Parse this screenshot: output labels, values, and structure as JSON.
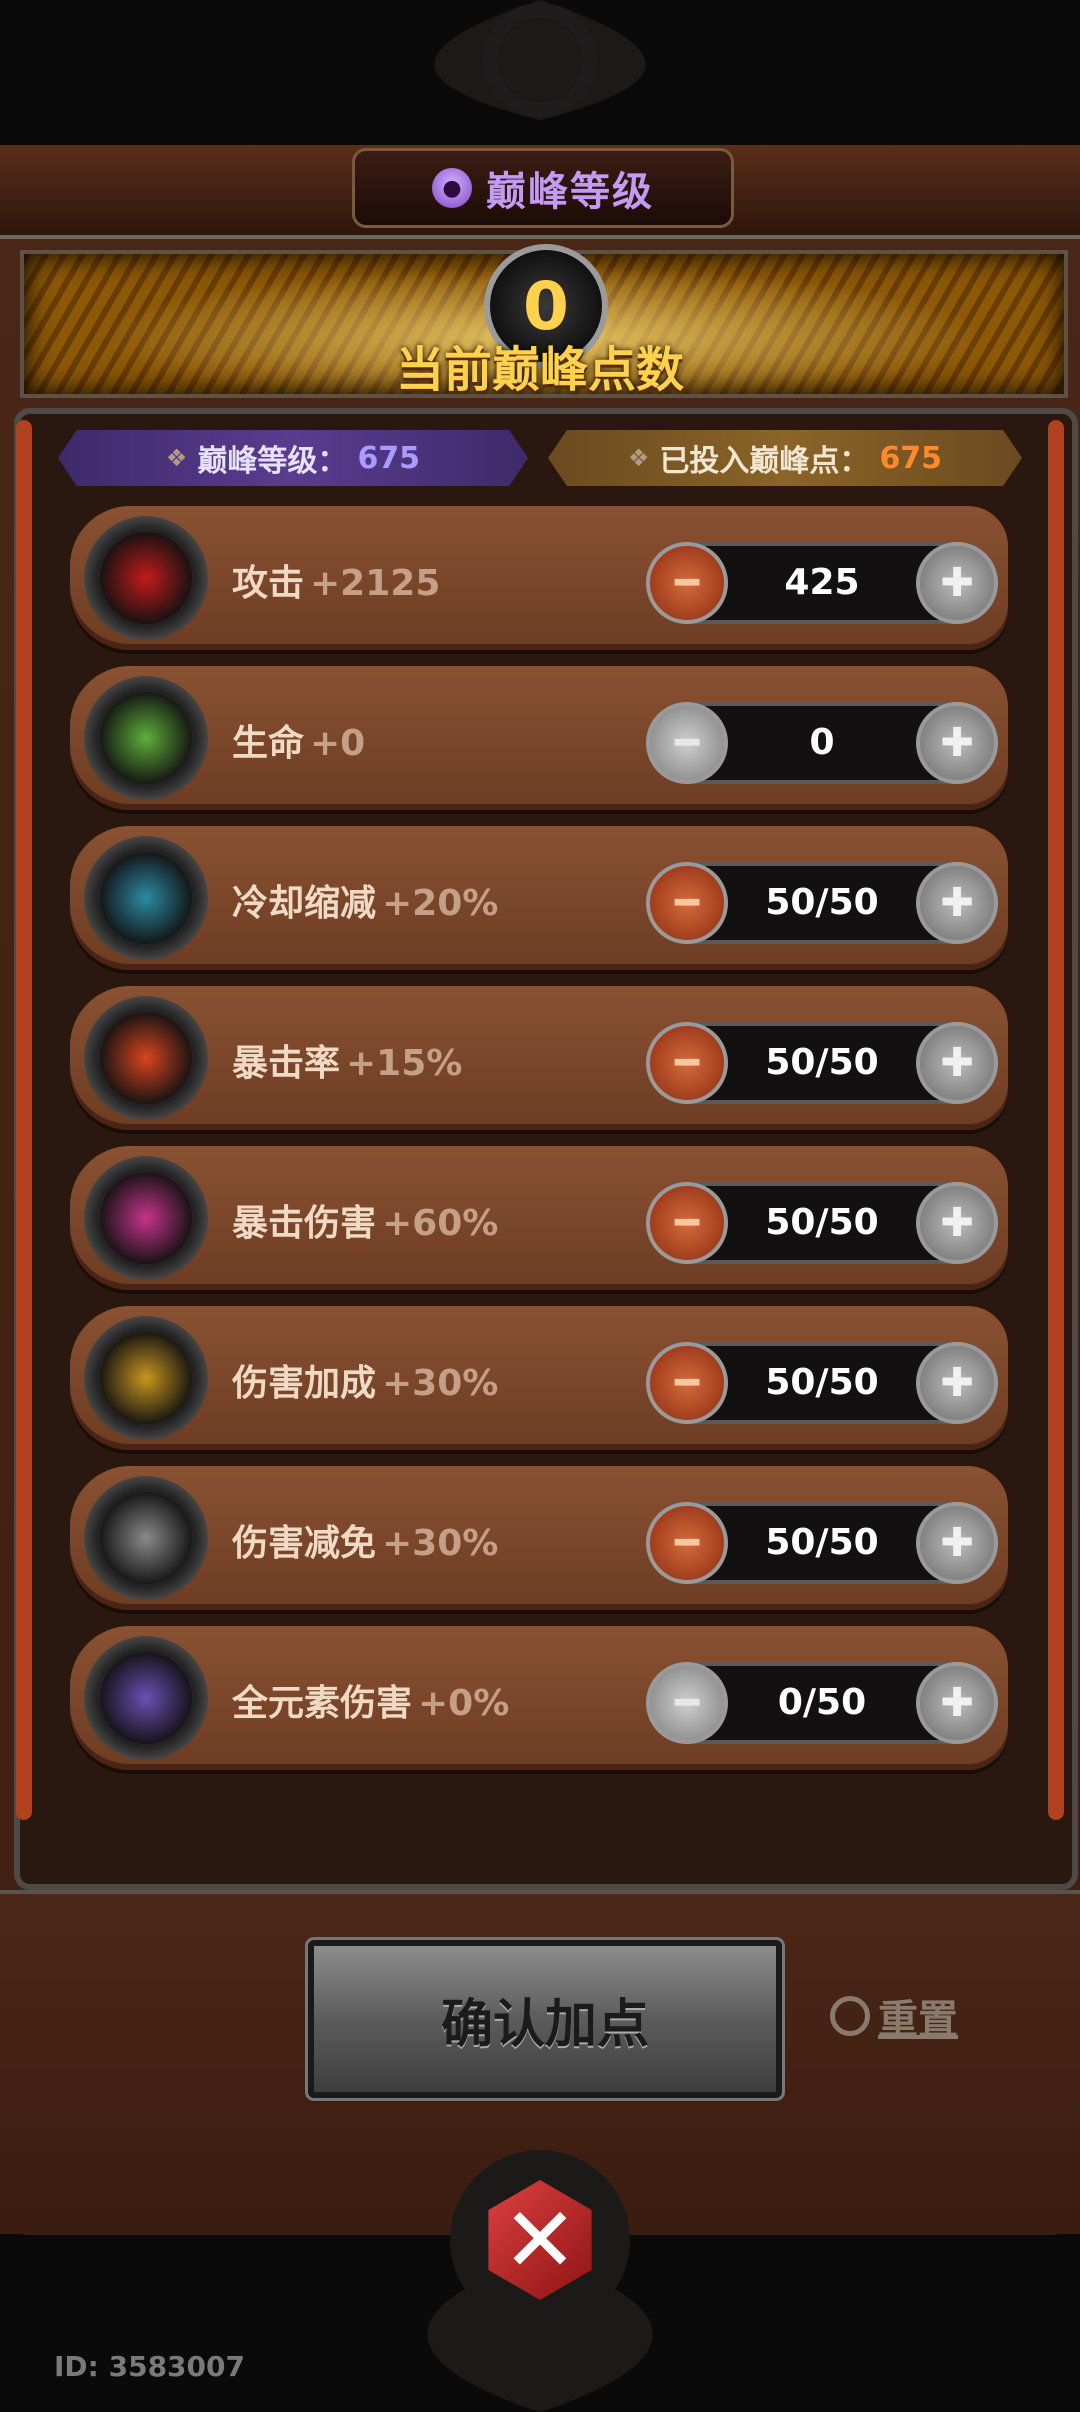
{
  "header": {
    "title": "巅峰等级"
  },
  "points": {
    "value": "0",
    "label": "当前巅峰点数"
  },
  "info": {
    "level_label": "巅峰等级：",
    "level_value": "675",
    "invested_label": "已投入巅峰点：",
    "invested_value": "675"
  },
  "rows": [
    {
      "name": "攻击",
      "bonus": "+2125",
      "value": "425",
      "minus_enabled": true,
      "icon": "attack-target-icon",
      "color": "#c21b1b"
    },
    {
      "name": "生命",
      "bonus": "+0",
      "value": "0",
      "minus_enabled": false,
      "icon": "life-cross-icon",
      "color": "#5fae3a"
    },
    {
      "name": "冷却缩减",
      "bonus": "+20%",
      "value": "50/50",
      "minus_enabled": true,
      "icon": "cooldown-clock-icon",
      "color": "#2b8aa3"
    },
    {
      "name": "暴击率",
      "bonus": "+15%",
      "value": "50/50",
      "minus_enabled": true,
      "icon": "crit-rate-spike-icon",
      "color": "#d8451f"
    },
    {
      "name": "暴击伤害",
      "bonus": "+60%",
      "value": "50/50",
      "minus_enabled": true,
      "icon": "crit-damage-arrow-icon",
      "color": "#c5348c"
    },
    {
      "name": "伤害加成",
      "bonus": "+30%",
      "value": "50/50",
      "minus_enabled": true,
      "icon": "damage-bonus-bolt-icon",
      "color": "#c9951e"
    },
    {
      "name": "伤害减免",
      "bonus": "+30%",
      "value": "50/50",
      "minus_enabled": true,
      "icon": "damage-reduction-shield-icon",
      "color": "#8a8a8a"
    },
    {
      "name": "全元素伤害",
      "bonus": "+0%",
      "value": "0/50",
      "minus_enabled": false,
      "icon": "all-element-orbs-icon",
      "color": "#6a4fb5"
    }
  ],
  "actions": {
    "confirm": "确认加点",
    "reset": "重置"
  },
  "footer": {
    "id": "ID: 3583007"
  }
}
